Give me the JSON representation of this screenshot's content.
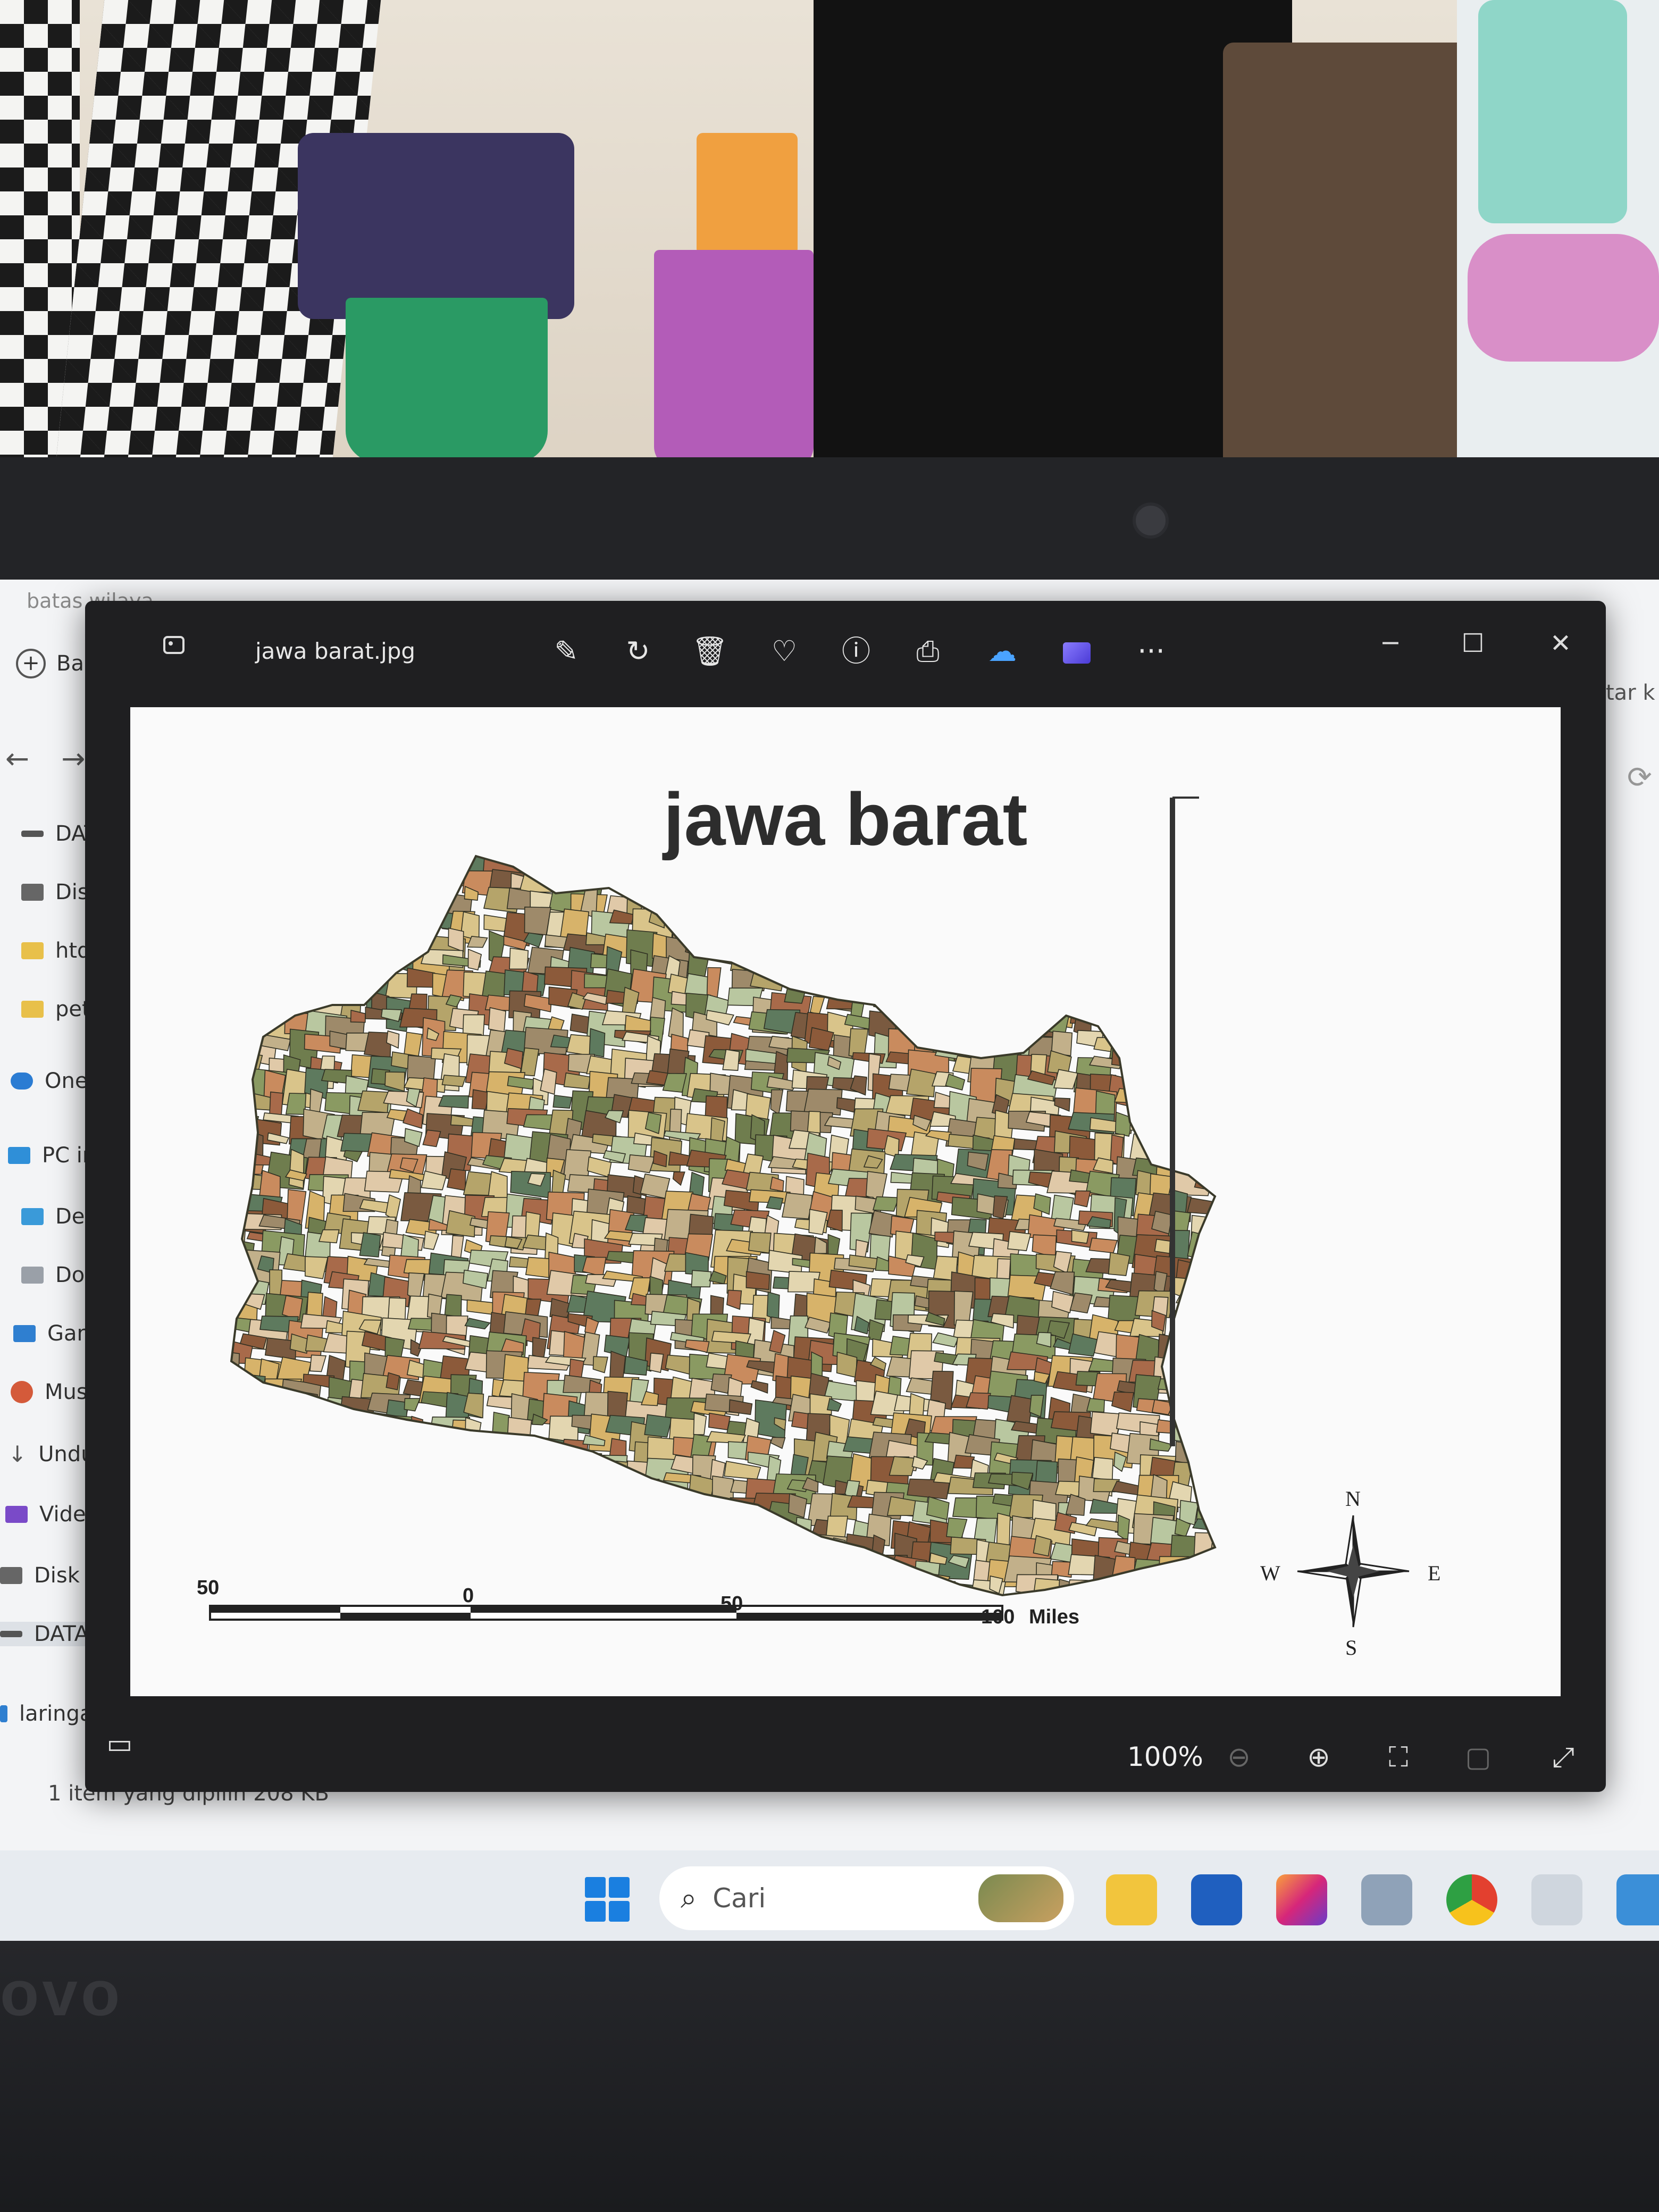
{
  "explorer": {
    "title": "batas wilaya",
    "new_label": "Baru",
    "nav_items": [
      "DATA",
      "Disk l",
      "htdoc",
      "peta",
      "OneDri",
      "PC ini",
      "Deskt",
      "Doku",
      "Gamb",
      "Musik",
      "Undu",
      "Video",
      "Disk l",
      "DATA",
      "laringa"
    ],
    "status_text": "1 item yang dipilih  208 KB",
    "right_text": "tar k"
  },
  "viewer": {
    "filename": "jawa barat.jpg",
    "toolbar_icons": [
      "edit-image-icon",
      "rotate-icon",
      "delete-icon",
      "favorite-icon",
      "info-icon",
      "print-icon",
      "onedrive-icon",
      "clipchamp-icon",
      "more-icon"
    ],
    "zoom": "100%",
    "image": {
      "title": "jawa barat",
      "scale_labels": [
        "50",
        "0",
        "50",
        "100",
        "Miles"
      ],
      "compass": {
        "n": "N",
        "s": "S",
        "e": "E",
        "w": "W"
      },
      "palette": [
        "#b5a46a",
        "#8a9a62",
        "#c98b5e",
        "#d9c48a",
        "#6f7d4e",
        "#a86a4a",
        "#e3d6b0",
        "#9e8a6a",
        "#5e7a5e",
        "#c2b08a",
        "#7a5a40",
        "#d7b36a",
        "#b9c7a0",
        "#8c5a3a",
        "#e0c9a8"
      ]
    }
  },
  "taskbar": {
    "search_placeholder": "Cari"
  },
  "laptop": {
    "brand": "ovo"
  }
}
